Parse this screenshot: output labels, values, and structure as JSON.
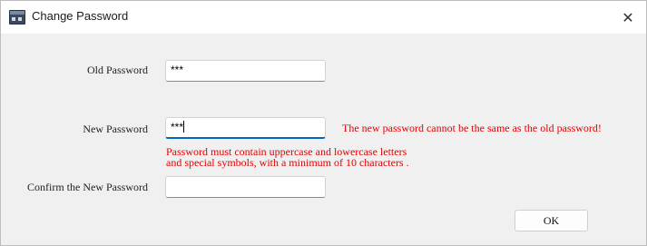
{
  "window": {
    "title": "Change Password",
    "close_glyph": "✕",
    "app_icon": "app-window-icon"
  },
  "form": {
    "old_password": {
      "label": "Old Password",
      "value": "***"
    },
    "new_password": {
      "label": "New Password",
      "value": "***",
      "error": "The new password cannot be the same as the old password!",
      "hint_line1": "Password must contain uppercase and lowercase letters",
      "hint_line2": "and special symbols, with a minimum of 10 characters ."
    },
    "confirm_password": {
      "label": "Confirm the New Password",
      "value": ""
    }
  },
  "buttons": {
    "ok_label": "OK"
  },
  "colors": {
    "error": "#e50000",
    "focus_accent": "#0067c0",
    "background": "#f0f0f0"
  }
}
